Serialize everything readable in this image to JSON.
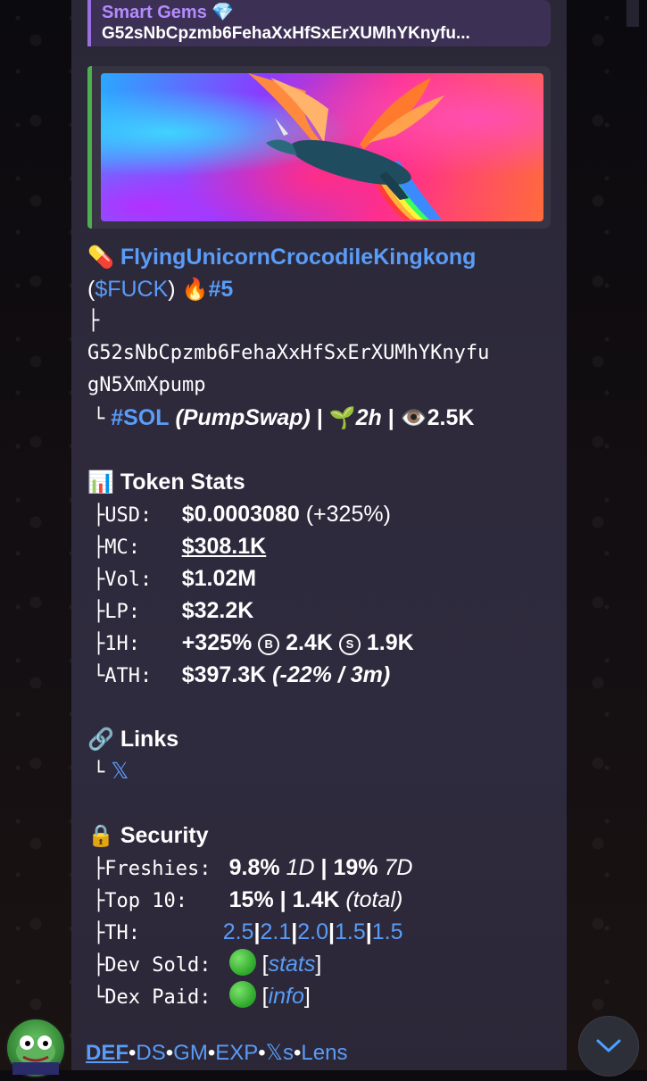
{
  "reply": {
    "title": "Smart Gems 💎",
    "text": "G52sNbCpzmb6FehaXxHfSxErXUMhYKnyfu..."
  },
  "token": {
    "pill_emoji": "💊",
    "name": "FlyingUnicornCrocodileKingkong",
    "paren_open": "(",
    "ticker": "$FUCK",
    "paren_close": ")",
    "fire_emoji": "🔥",
    "rank": "#5",
    "branch1": "├",
    "address_line1": "G52sNbCpzmb6FehaXxHfSxErXUMhYKnyfu",
    "address_line2": "gN5XmXpump",
    "branch2": "└",
    "chain": "#SOL",
    "dex": "(PumpSwap)",
    "sep": "|",
    "sprout_emoji": "🌱",
    "age": "2h",
    "eye_emoji": "👁️",
    "views": "2.5K"
  },
  "stats": {
    "header_emoji": "📊",
    "header": "Token Stats",
    "rows": [
      {
        "branch": "├",
        "key": "USD:  ",
        "value": "$0.0003080",
        "extra": " (+325%)"
      },
      {
        "branch": "├",
        "key": "MC:   ",
        "value": "$308.1K"
      },
      {
        "branch": "├",
        "key": "Vol:  ",
        "value": "$1.02M"
      },
      {
        "branch": "├",
        "key": "LP:   ",
        "value": "$32.2K"
      },
      {
        "branch": "├",
        "key": "1H:   ",
        "value": "+325%",
        "buy_icon": "B",
        "buy": "2.4K",
        "sell_icon": "S",
        "sell": "1.9K"
      },
      {
        "branch": "└",
        "key": "ATH:  ",
        "value": "$397.3K",
        "extra": " (-22% / 3m)"
      }
    ]
  },
  "links": {
    "header_emoji": "🔗",
    "header": "Links",
    "branch": "└",
    "x_label": "𝕏"
  },
  "security": {
    "header_emoji": "🔒",
    "header": "Security",
    "freshies_branch": "├",
    "freshies_key": "Freshies: ",
    "freshies_1d": "9.8%",
    "freshies_1d_label": "1D",
    "freshies_7d": "19%",
    "freshies_7d_label": "7D",
    "top10_branch": "├",
    "top10_key": "Top 10:   ",
    "top10_pct": "15%",
    "top10_total": "1.4K",
    "top10_total_label": "(total)",
    "th_branch": "├",
    "th_key": "TH:       ",
    "th_values": [
      "2.5",
      "2.1",
      "2.0",
      "1.5",
      "1.5"
    ],
    "devsold_branch": "├",
    "devsold_key": "Dev Sold: ",
    "devsold_link": "stats",
    "dexpaid_branch": "└",
    "dexpaid_key": "Dex Paid: ",
    "dexpaid_link": "info",
    "bracket_open": "[",
    "bracket_close": "]",
    "pipe": "|"
  },
  "bottom_links": [
    "DEF",
    "DS",
    "GM",
    "EXP",
    "𝕏s",
    "Lens"
  ],
  "bottom_sep": "•",
  "icons": {
    "scroll_down": "chevron-down-icon",
    "avatar": "pepe-avatar"
  },
  "colors": {
    "link": "#5a9cf7",
    "reply_title": "#b48bff",
    "preview_border": "#4caf50"
  }
}
